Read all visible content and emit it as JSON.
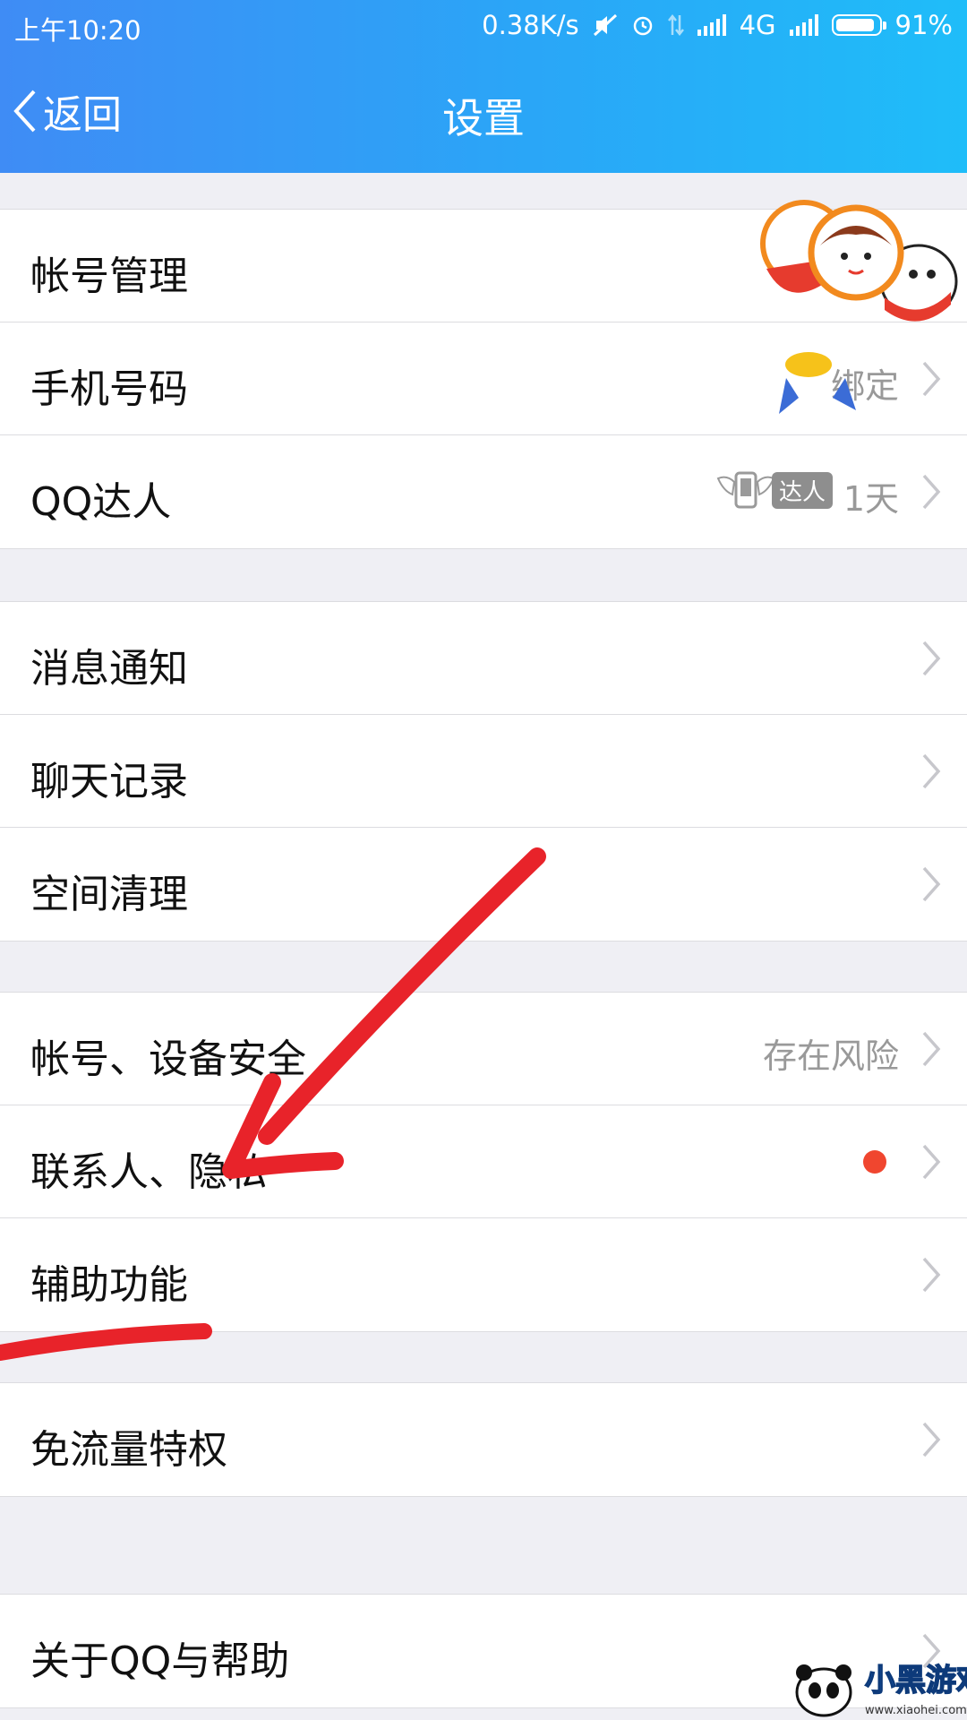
{
  "status_bar": {
    "time": "上午10:20",
    "network_speed": "0.38K/s",
    "network_type": "4G",
    "battery_percent": "91%",
    "battery_level": 0.91,
    "icons": [
      "mute-icon",
      "alarm-icon",
      "data-arrows-icon",
      "signal-icon",
      "signal-icon-2",
      "battery-icon"
    ]
  },
  "nav": {
    "back_label": "返回",
    "title": "设置"
  },
  "groups": [
    {
      "items": [
        {
          "label": "帐号管理"
        },
        {
          "label": "手机号码",
          "value": "绑定"
        },
        {
          "label": "QQ达人",
          "badge": "达人",
          "value": "1天"
        }
      ]
    },
    {
      "items": [
        {
          "label": "消息通知"
        },
        {
          "label": "聊天记录"
        },
        {
          "label": "空间清理"
        }
      ]
    },
    {
      "items": [
        {
          "label": "帐号、设备安全",
          "value": "存在风险"
        },
        {
          "label": "联系人、隐私",
          "has_dot": true
        },
        {
          "label": "辅助功能"
        }
      ]
    },
    {
      "items": [
        {
          "label": "免流量特权"
        }
      ]
    },
    {
      "items": [
        {
          "label": "关于QQ与帮助"
        }
      ]
    }
  ],
  "watermark": {
    "site": "www.xiaohei.com"
  },
  "colors": {
    "header_start": "#3f8cf5",
    "header_end": "#1fbdf9",
    "dot": "#f0462f",
    "annotation": "#e8232a"
  }
}
